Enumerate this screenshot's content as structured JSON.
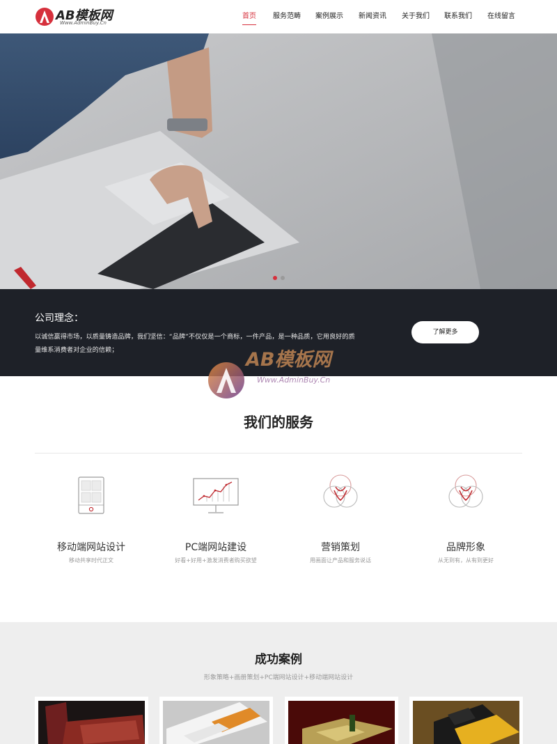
{
  "header": {
    "logo_text": "AB模板网",
    "logo_sub": "Www.AdminBuy.Cn",
    "nav": [
      "首页",
      "服务范畴",
      "案例展示",
      "新闻资讯",
      "关于我们",
      "联系我们",
      "在线留言"
    ]
  },
  "philosophy": {
    "title": "公司理念：",
    "text": "以诚信赢得市场，以质量铸造品牌，我们坚信：“品牌”不仅仅是一个商标，一件产品，是一种品质，它用良好的质量维系消费者对企业的信赖；",
    "button": "了解更多"
  },
  "watermark": {
    "text": "AB模板网",
    "sub": "Www.AdminBuy.Cn"
  },
  "services": {
    "title": "我们的服务",
    "items": [
      {
        "name": "移动端网站设计",
        "desc": "移动共享时代正文",
        "icon": "mobile-icon"
      },
      {
        "name": "PC端网站建设",
        "desc": "好看+好用+激发消费者购买欲望",
        "icon": "chart-monitor-icon"
      },
      {
        "name": "营销策划",
        "desc": "用画面让产品和服务说话",
        "icon": "circles-icon"
      },
      {
        "name": "品牌形象",
        "desc": "从无到有，从有到更好",
        "icon": "circles-icon"
      }
    ]
  },
  "cases": {
    "title": "成功案例",
    "subtitle": "形象策略+画册策划+PC端网站设计+移动端网站设计"
  },
  "colors": {
    "accent": "#d6303c",
    "band_bg": "#1e2128",
    "cases_bg": "#eeeeee"
  }
}
